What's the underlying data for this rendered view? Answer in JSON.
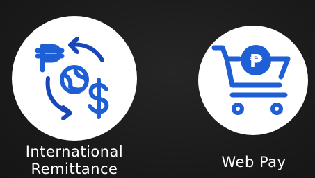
{
  "tiles": [
    {
      "id": "international-remittance",
      "label_line1": "International",
      "label_line2": "Remittance",
      "icon": "currency-exchange-icon",
      "currency_from": "₱",
      "currency_to": "$"
    },
    {
      "id": "web-pay",
      "label": "Web Pay",
      "icon": "shopping-cart-peso-icon",
      "coin_symbol": "₱"
    }
  ],
  "colors": {
    "icon_blue": "#1f5fd6",
    "icon_blue_dark": "#1a47b8",
    "circle_bg": "#ffffff",
    "label_text": "#ffffff"
  }
}
